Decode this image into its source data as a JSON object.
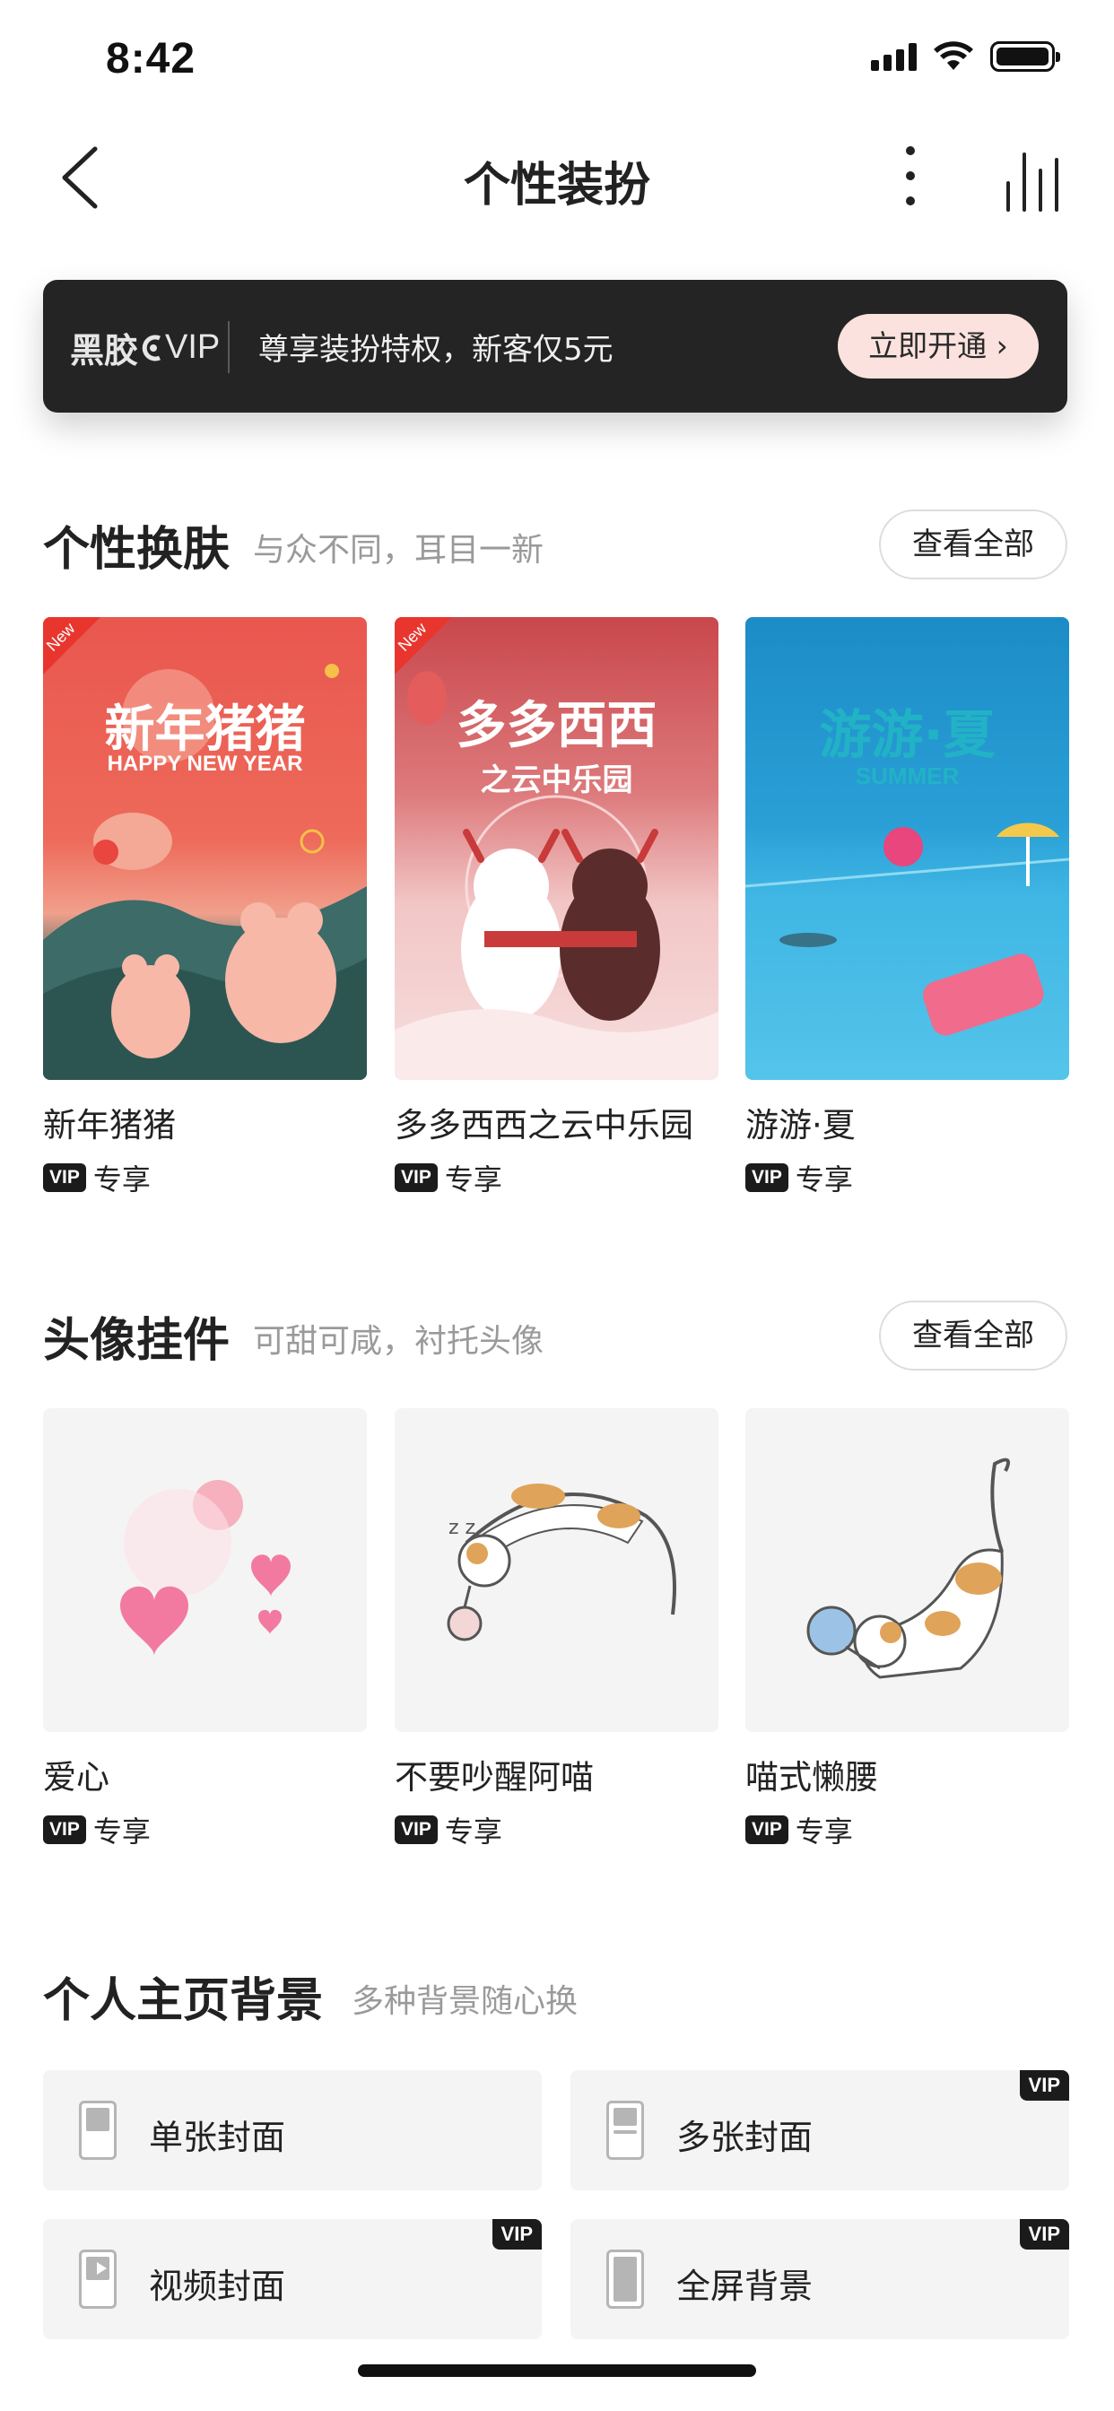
{
  "status_bar": {
    "time": "8:42"
  },
  "nav": {
    "title": "个性装扮"
  },
  "vip_banner": {
    "logo": "黑胶",
    "logo_mark": "VIP",
    "description": "尊享装扮特权，新客仅5元",
    "button": "立即开通 ›"
  },
  "skins": {
    "title": "个性换肤",
    "subtitle": "与众不同，耳目一新",
    "view_all": "查看全部",
    "items": [
      {
        "name": "新年猪猪",
        "badge": "专享",
        "corner": "New",
        "art_title": "新年猪猪",
        "art_sub": "HAPPY NEW YEAR"
      },
      {
        "name": "多多西西之云中乐园",
        "badge": "专享",
        "corner": "New",
        "art_title": "多多西西",
        "art_sub": "之云中乐园"
      },
      {
        "name": "游游·夏",
        "badge": "专享",
        "art_title": "游游·夏",
        "art_sub": "SUMMER"
      }
    ]
  },
  "avatar_frames": {
    "title": "头像挂件",
    "subtitle": "可甜可咸，衬托头像",
    "view_all": "查看全部",
    "items": [
      {
        "name": "爱心",
        "badge": "专享"
      },
      {
        "name": "不要吵醒阿喵",
        "badge": "专享"
      },
      {
        "name": "喵式懒腰",
        "badge": "专享"
      }
    ]
  },
  "backgrounds": {
    "title": "个人主页背景",
    "subtitle": "多种背景随心换",
    "items": [
      {
        "label": "单张封面"
      },
      {
        "label": "多张封面"
      },
      {
        "label": "视频封面"
      },
      {
        "label": "全屏背景"
      }
    ]
  },
  "svip_mark": "VIP",
  "colors": {
    "banner_bg": "#242424",
    "button_bg": "#fbe2de",
    "badge_bg": "#1b1b1b",
    "new_corner": "#e8362e"
  }
}
